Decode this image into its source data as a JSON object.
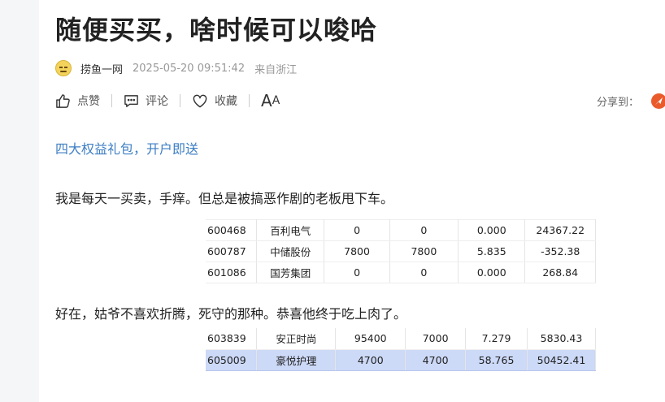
{
  "article": {
    "title": "随便买买，啥时候可以唆哈",
    "author": "捞鱼一网",
    "time": "2025-05-20 09:51:42",
    "origin": "来自浙江"
  },
  "actions": {
    "like": "点赞",
    "comment": "评论",
    "favorite": "收藏",
    "font_big": "A",
    "font_small": "A",
    "share": "分享到："
  },
  "promo": "四大权益礼包，开户即送",
  "paragraphs": {
    "p1": "我是每天一买卖，手痒。但总是被搞恶作剧的老板甩下车。",
    "p2": "好在，姑爷不喜欢折腾，死守的那种。恭喜他终于吃上肉了。"
  },
  "table1": [
    [
      "600468",
      "百利电气",
      "0",
      "0",
      "0.000",
      "24367.22"
    ],
    [
      "600787",
      "中储股份",
      "7800",
      "7800",
      "5.835",
      "-352.38"
    ],
    [
      "601086",
      "国芳集团",
      "0",
      "0",
      "0.000",
      "268.84"
    ]
  ],
  "table2": [
    [
      "603839",
      "安正时尚",
      "95400",
      "7000",
      "7.279",
      "5830.43"
    ],
    [
      "605009",
      "豪悦护理",
      "4700",
      "4700",
      "58.765",
      "50452.41"
    ]
  ],
  "colors": {
    "link": "#3d7ec3",
    "highlight_row": "#ccd9f7",
    "share_icon": "#ea5b2c"
  },
  "icons": {
    "like": "thumbs-up-icon",
    "comment": "comment-icon",
    "favorite": "heart-icon",
    "share": "share-platform-icon"
  }
}
